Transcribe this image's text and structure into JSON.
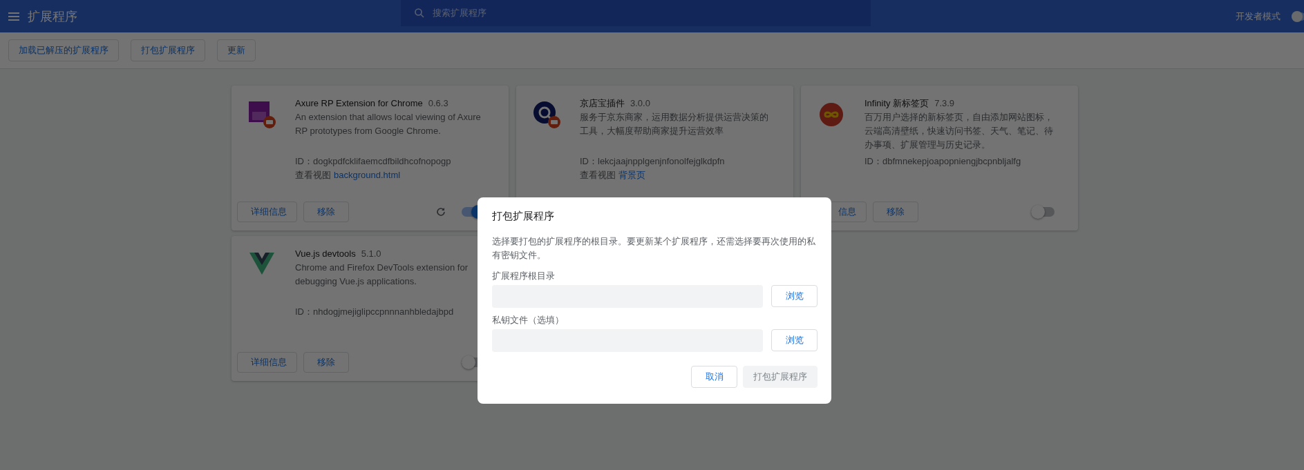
{
  "header": {
    "title": "扩展程序",
    "search": {
      "placeholder": "搜索扩展程序"
    },
    "developer_mode": {
      "label": "开发者模式"
    }
  },
  "toolbar": {
    "buttons": [
      "加载已解压的扩展程序",
      "打包扩展程序",
      "更新"
    ]
  },
  "extensions": [
    {
      "name": "Axure RP Extension for Chrome",
      "version": "0.6.3",
      "description": "An extension that allows local viewing of Axure RP prototypes from Google Chrome.",
      "id_label": "ID：dogkpdfcklifaemcdfbildhcofnopogp",
      "views_label": "查看视图",
      "view_link": "background.html",
      "buttons": [
        "详细信息",
        "移除"
      ],
      "reload": true,
      "enabled": true
    },
    {
      "name": "京店宝插件",
      "version": "3.0.0",
      "description": "服务于京东商家，运用数据分析提供运营决策的工具，大幅度帮助商家提升运营效率",
      "id_label": "ID：lekcjaajnpplgenjnfonolfejglkdpfn",
      "views_label": "查看视图",
      "view_link": "背景页"
    },
    {
      "name": "Infinity 新标签页",
      "version": "7.3.9",
      "description": "百万用户选择的新标签页，自由添加网站图标，云端高清壁纸，快速访问书签、天气、笔记、待办事项、扩展管理与历史记录。",
      "id_label": "ID：dbfmnekepjoapopniengjbcpnbljalfg",
      "buttons": [
        "信息",
        "移除"
      ],
      "reload": false,
      "enabled": false
    },
    {
      "name": "Vue.js devtools",
      "version": "5.1.0",
      "description": "Chrome and Firefox DevTools extension for debugging Vue.js applications.",
      "id_label": "ID：nhdogjmejiglipccpnnnanhbledajbpd",
      "buttons": [
        "详细信息",
        "移除"
      ],
      "reload": false,
      "enabled": false
    }
  ],
  "dialog": {
    "title": "打包扩展程序",
    "description": "选择要打包的扩展程序的根目录。要更新某个扩展程序，还需选择要再次使用的私有密钥文件。",
    "fields": [
      {
        "label": "扩展程序根目录",
        "browse": "浏览"
      },
      {
        "label": "私钥文件（选填）",
        "browse": "浏览"
      }
    ],
    "buttons": [
      {
        "label": "取消",
        "disabled": false
      },
      {
        "label": "打包扩展程序",
        "disabled": true
      }
    ]
  }
}
